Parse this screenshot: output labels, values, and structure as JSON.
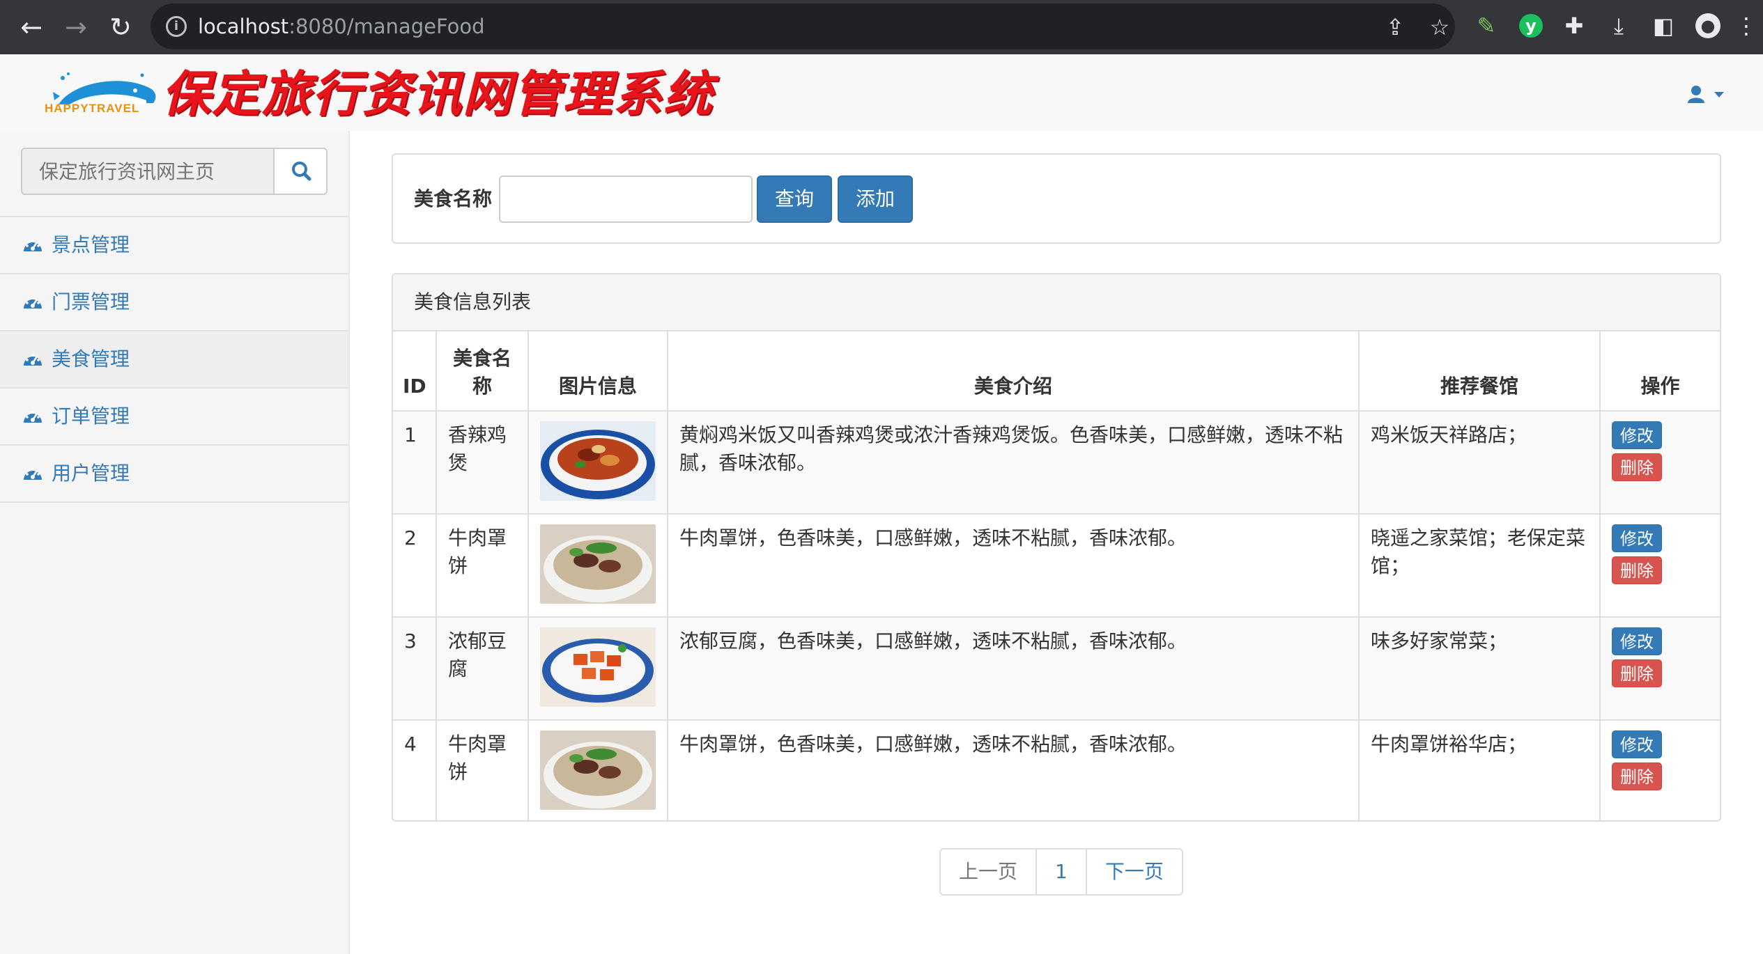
{
  "browser": {
    "url_host": "localhost",
    "url_path": ":8080/manageFood"
  },
  "header": {
    "logo_text": "HAPPYTRAVEL",
    "title": "保定旅行资讯网管理系统"
  },
  "sidebar": {
    "search_placeholder": "保定旅行资讯网主页",
    "items": [
      {
        "label": "景点管理",
        "active": false
      },
      {
        "label": "门票管理",
        "active": false
      },
      {
        "label": "美食管理",
        "active": true
      },
      {
        "label": "订单管理",
        "active": false
      },
      {
        "label": "用户管理",
        "active": false
      }
    ]
  },
  "search": {
    "label": "美食名称",
    "value": "",
    "query_button": "查询",
    "add_button": "添加"
  },
  "list": {
    "heading": "美食信息列表",
    "columns": {
      "id": "ID",
      "name": "美食名称",
      "image": "图片信息",
      "intro": "美食介绍",
      "restaurant": "推荐餐馆",
      "ops": "操作"
    },
    "rows": [
      {
        "id": "1",
        "name": "香辣鸡煲",
        "intro": "黄焖鸡米饭又叫香辣鸡煲或浓汁香辣鸡煲饭。色香味美，口感鲜嫩，透味不粘腻，香味浓郁。",
        "restaurant": "鸡米饭天祥路店；",
        "edit": "修改",
        "delete": "删除"
      },
      {
        "id": "2",
        "name": "牛肉罩饼",
        "intro": "牛肉罩饼，色香味美，口感鲜嫩，透味不粘腻，香味浓郁。",
        "restaurant": "晓遥之家菜馆；老保定菜馆；",
        "edit": "修改",
        "delete": "删除"
      },
      {
        "id": "3",
        "name": "浓郁豆腐",
        "intro": "浓郁豆腐，色香味美，口感鲜嫩，透味不粘腻，香味浓郁。",
        "restaurant": "味多好家常菜；",
        "edit": "修改",
        "delete": "删除"
      },
      {
        "id": "4",
        "name": "牛肉罩饼",
        "intro": "牛肉罩饼，色香味美，口感鲜嫩，透味不粘腻，香味浓郁。",
        "restaurant": "牛肉罩饼裕华店；",
        "edit": "修改",
        "delete": "删除"
      }
    ]
  },
  "pagination": {
    "prev": "上一页",
    "current": "1",
    "next": "下一页"
  },
  "colors": {
    "primary": "#337ab7",
    "danger": "#d9534f",
    "title_red": "#e8141c"
  }
}
